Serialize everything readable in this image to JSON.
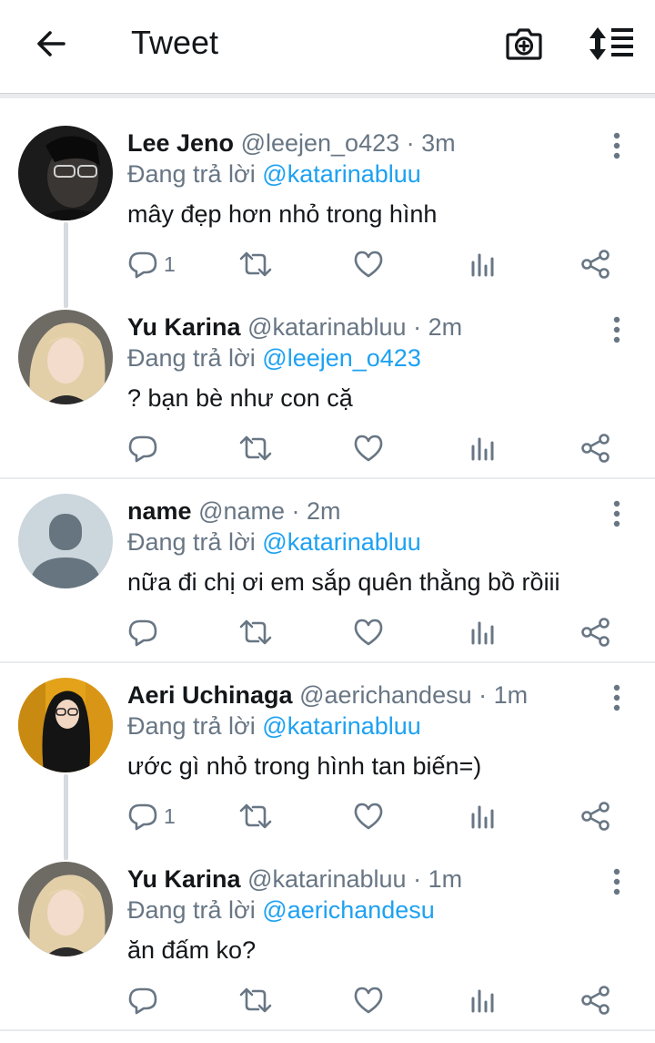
{
  "header": {
    "title": "Tweet",
    "back_icon": "arrow-left-icon",
    "camera_icon": "camera-add-icon",
    "sort_icon": "sort-icon"
  },
  "colors": {
    "link": "#1da1f2",
    "muted": "#687684",
    "text": "#14171a"
  },
  "reply_prefix": "Đang trả lời",
  "tweets": [
    {
      "name": "Lee Jeno",
      "handle": "@leejen_o423",
      "time": "· 3m",
      "mention": "@katarinabluu",
      "text": "mây đẹp hơn nhỏ trong hình",
      "reply_count": "1"
    },
    {
      "name": "Yu Karina",
      "handle": "@katarinabluu",
      "time": "· 2m",
      "mention": "@leejen_o423",
      "text": "? bạn bè như con cặ",
      "reply_count": ""
    },
    {
      "name": "name",
      "handle": "@name",
      "time": "· 2m",
      "mention": "@katarinabluu",
      "text": "nữa đi chị ơi em sắp quên thằng bồ rồiii",
      "reply_count": ""
    },
    {
      "name": "Aeri Uchinaga",
      "handle": "@aerichandesu",
      "time": "· 1m",
      "mention": "@katarinabluu",
      "text": "ước gì nhỏ trong hình tan biến=)",
      "reply_count": "1"
    },
    {
      "name": "Yu Karina",
      "handle": "@katarinabluu",
      "time": "· 1m",
      "mention": "@aerichandesu",
      "text": "ăn đấm ko?",
      "reply_count": ""
    }
  ]
}
